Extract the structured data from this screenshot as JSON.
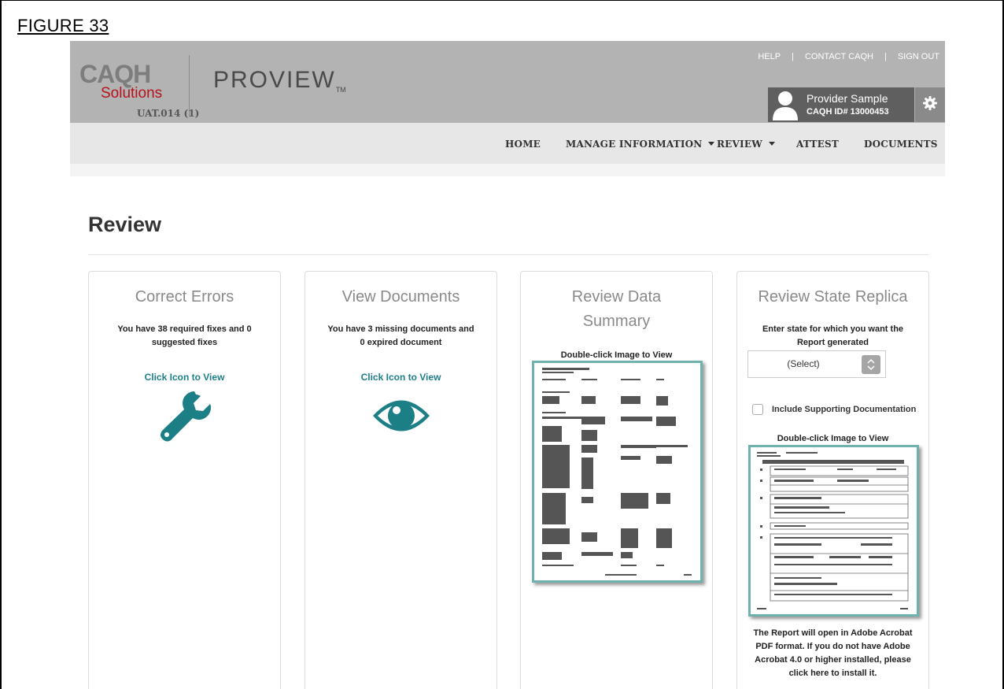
{
  "figure_label": "FIGURE 33",
  "header": {
    "logo_caqh": "CAQH",
    "logo_solutions": "Solutions",
    "product": "PROVIEW",
    "product_tm": "TM",
    "version": "UAT.014 (1)",
    "links": [
      "HELP",
      "CONTACT CAQH",
      "SIGN OUT"
    ],
    "user": {
      "name": "Provider Sample",
      "caqh_id": "CAQH ID# 13000453"
    }
  },
  "nav": {
    "home": "HOME",
    "manage": "MANAGE INFORMATION",
    "review": "REVIEW",
    "attest": "ATTEST",
    "documents": "DOCUMENTS"
  },
  "page": {
    "title": "Review"
  },
  "cards": {
    "correct_errors": {
      "title": "Correct Errors",
      "text": "You have 38 required fixes and 0 suggested fixes",
      "link": "Click Icon to View",
      "icon": "wrench-icon",
      "icon_color": "#1d7f86"
    },
    "view_documents": {
      "title": "View Documents",
      "text": "You have 3 missing documents and 0 expired document",
      "link": "Click Icon to View",
      "icon": "eye-icon",
      "icon_color": "#1d7f86"
    },
    "review_data_summary": {
      "title": "Review Data Summary",
      "thumb_caption": "Double-click Image to View"
    },
    "review_state_replica": {
      "title": "Review State Replica",
      "instruction": "Enter state for which you want the Report generated",
      "select_value": "(Select)",
      "checkbox_label": "Include Supporting Documentation",
      "thumb_caption": "Double-click Image to View",
      "note": "The Report will open in Adobe Acrobat PDF format. If you do not have Adobe Acrobat 4.0 or higher installed, please click here to install it."
    }
  },
  "colors": {
    "accent": "#1d7f86",
    "header_bg": "#b3b3b3",
    "nav_bg": "#e7e7e7",
    "brand_red": "#b5121b"
  }
}
